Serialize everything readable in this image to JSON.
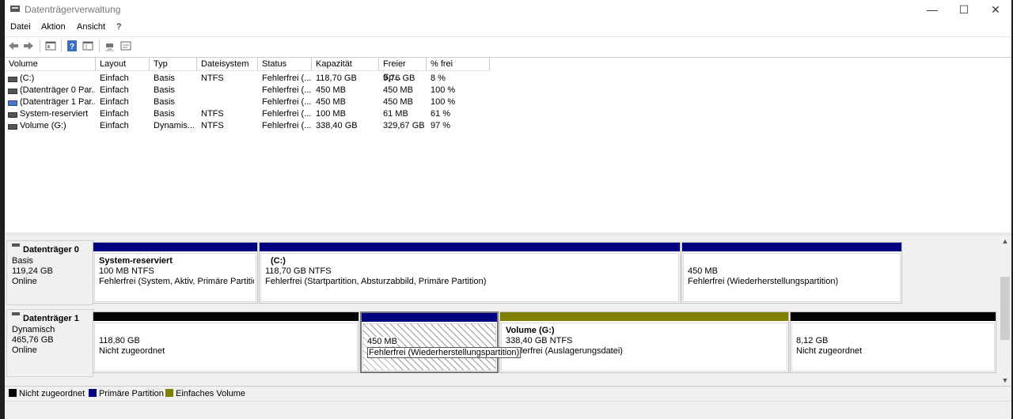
{
  "window": {
    "title": "Datenträgerverwaltung"
  },
  "menu": [
    "Datei",
    "Aktion",
    "Ansicht",
    "?"
  ],
  "list": {
    "columns": [
      "Volume",
      "Layout",
      "Typ",
      "Dateisystem",
      "Status",
      "Kapazität",
      "Freier Sp...",
      "% frei"
    ],
    "rows": [
      [
        "(C:)",
        "Einfach",
        "Basis",
        "NTFS",
        "Fehlerfrei (...",
        "118,70 GB",
        "9,76 GB",
        "8 %"
      ],
      [
        "(Datenträger 0 Par...",
        "Einfach",
        "Basis",
        "",
        "Fehlerfrei (...",
        "450 MB",
        "450 MB",
        "100 %"
      ],
      [
        "(Datenträger 1 Par...",
        "Einfach",
        "Basis",
        "",
        "Fehlerfrei (...",
        "450 MB",
        "450 MB",
        "100 %"
      ],
      [
        "System-reserviert",
        "Einfach",
        "Basis",
        "NTFS",
        "Fehlerfrei (...",
        "100 MB",
        "61 MB",
        "61 %"
      ],
      [
        "Volume (G:)",
        "Einfach",
        "Dynamis...",
        "NTFS",
        "Fehlerfrei (...",
        "338,40 GB",
        "329,67 GB",
        "97 %"
      ]
    ]
  },
  "disks": [
    {
      "name": "Datenträger 0",
      "type": "Basis",
      "size": "119,24 GB",
      "state": "Online",
      "partitions": [
        {
          "title": "System-reserviert",
          "size": "100 MB NTFS",
          "status": "Fehlerfrei (System, Aktiv, Primäre Partition)"
        },
        {
          "title": "(C:)",
          "size": "118,70 GB NTFS",
          "status": "Fehlerfrei (Startpartition, Absturzabbild, Primäre Partition)"
        },
        {
          "title": "",
          "size": "450 MB",
          "status": "Fehlerfrei (Wiederherstellungspartition)"
        }
      ]
    },
    {
      "name": "Datenträger 1",
      "type": "Dynamisch",
      "size": "465,76 GB",
      "state": "Online",
      "partitions": [
        {
          "title": "",
          "size": "118,80 GB",
          "status": "Nicht zugeordnet"
        },
        {
          "title": "",
          "size": "450 MB",
          "status": "Fehlerfrei (Wiederherstellungspartition)"
        },
        {
          "title": "Volume  (G:)",
          "size": "338,40 GB NTFS",
          "status": "Fehlerfrei (Auslagerungsdatei)"
        },
        {
          "title": "",
          "size": "8,12 GB",
          "status": "Nicht zugeordnet"
        }
      ]
    }
  ],
  "legend": [
    {
      "label": "Nicht zugeordnet",
      "color": "#000000"
    },
    {
      "label": "Primäre Partition",
      "color": "#000080"
    },
    {
      "label": "Einfaches Volume",
      "color": "#808000"
    }
  ],
  "colors": {
    "primary": "#000080",
    "unallocated": "#000000",
    "simple": "#808000"
  },
  "icons": [
    "back-icon",
    "forward-icon",
    "properties-icon",
    "help-icon",
    "view-icon",
    "connect-icon",
    "settings-icon"
  ]
}
